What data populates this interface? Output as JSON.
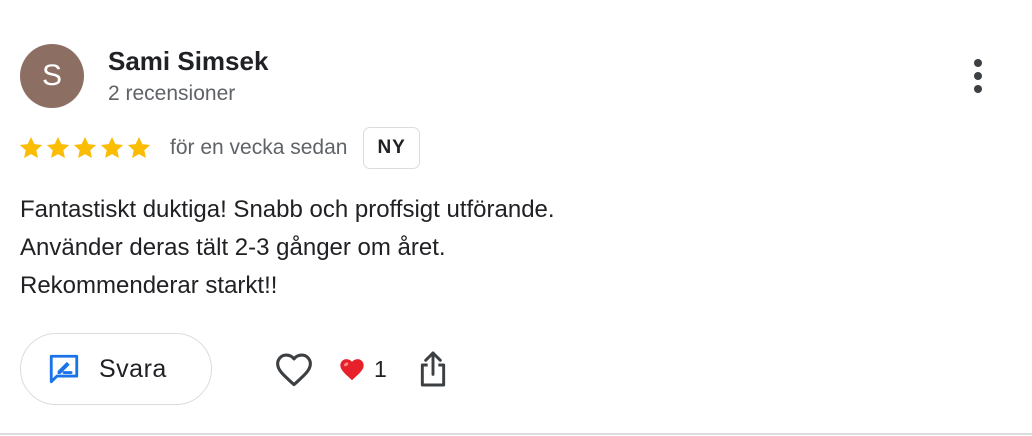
{
  "review": {
    "author": {
      "initial": "S",
      "name": "Sami Simsek",
      "review_count": "2 recensioner"
    },
    "rating": 5,
    "time": "för en vecka sedan",
    "badge": "NY",
    "text_lines": [
      "Fantastiskt duktiga! Snabb och proffsigt utförande.",
      "Använder deras tält 2-3 gånger om året.",
      "Rekommenderar starkt!!"
    ],
    "actions": {
      "reply_label": "Svara",
      "reaction_count": "1"
    }
  },
  "icons": {
    "more": "more-vert-icon",
    "star": "star-icon",
    "reply": "rate-review-icon",
    "like": "heart-outline-icon",
    "reaction": "red-heart-icon",
    "share": "share-icon"
  },
  "colors": {
    "star": "#fbbc04",
    "avatar_bg": "#8d6e63",
    "reply_icon": "#1a73e8",
    "reaction_heart": "#e8202a",
    "secondary_text": "#5f6368",
    "border": "#dadce0"
  }
}
